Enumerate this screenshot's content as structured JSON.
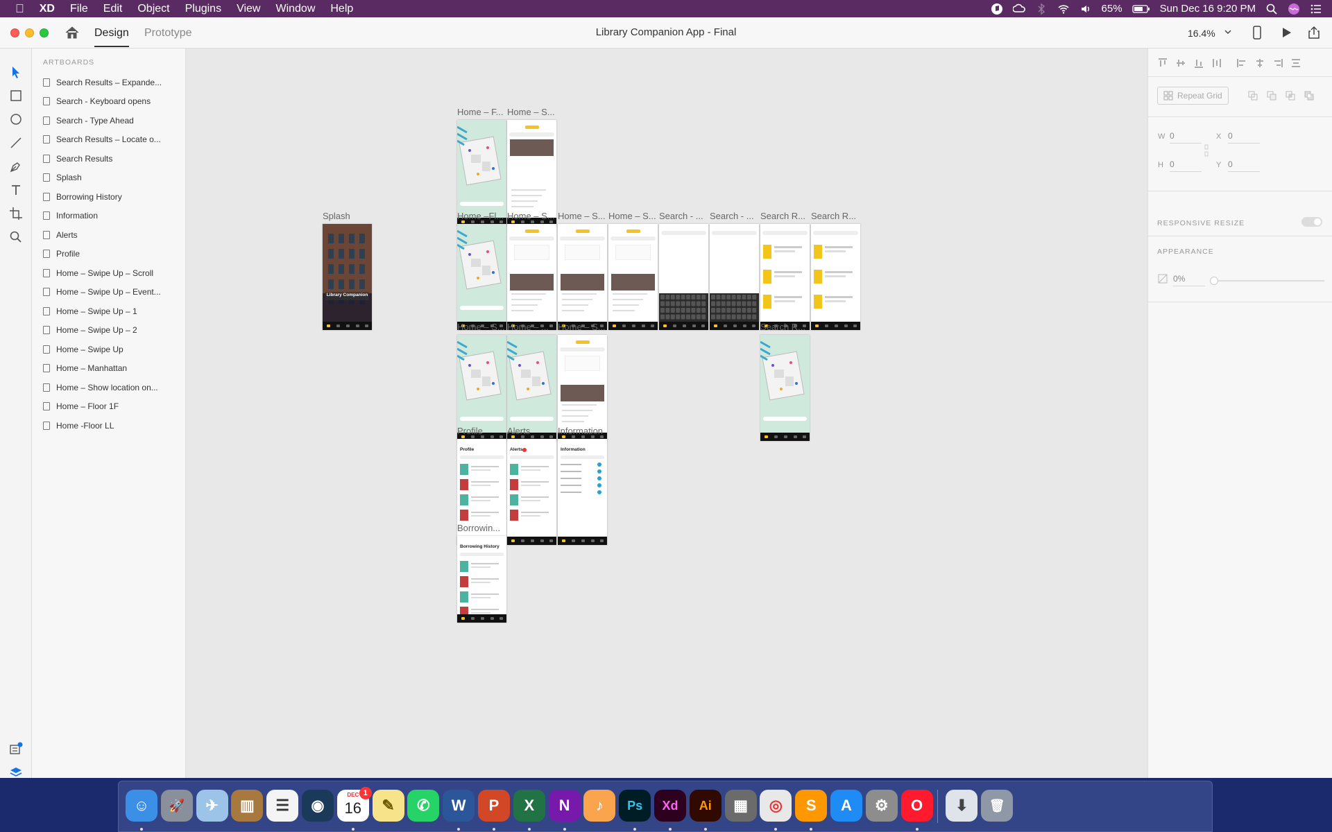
{
  "menubar": {
    "app_name": "XD",
    "menus": [
      "File",
      "Edit",
      "Object",
      "Plugins",
      "View",
      "Window",
      "Help"
    ],
    "battery": "65%",
    "datetime": "Sun Dec 16  9:20 PM"
  },
  "window": {
    "title": "Library Companion App - Final",
    "tabs": {
      "design": "Design",
      "prototype": "Prototype"
    },
    "zoom": "16.4%"
  },
  "layers": {
    "header": "ARTBOARDS",
    "items": [
      "Search Results – Expande...",
      "Search - Keyboard opens",
      "Search - Type Ahead",
      "Search Results – Locate o...",
      "Search Results",
      "Splash",
      "Borrowing History",
      "Information",
      "Alerts",
      "Profile",
      "Home – Swipe Up – Scroll",
      "Home – Swipe Up – Event...",
      "Home – Swipe Up – 1",
      "Home – Swipe Up – 2",
      "Home – Swipe Up",
      "Home – Manhattan",
      "Home – Show location on...",
      "Home – Floor 1F",
      "Home -Floor LL"
    ]
  },
  "canvas": {
    "artboards": [
      {
        "label": "Home – F...",
        "kind": "map"
      },
      {
        "label": "Home – S...",
        "kind": "detail"
      },
      {
        "label": "Splash",
        "kind": "splash",
        "text": "Library Companion"
      },
      {
        "label": "Home –Fl...",
        "kind": "map"
      },
      {
        "label": "Home – S...",
        "kind": "list"
      },
      {
        "label": "Home – S...",
        "kind": "list"
      },
      {
        "label": "Home – S...",
        "kind": "list"
      },
      {
        "label": "Search - ...",
        "kind": "keyboard"
      },
      {
        "label": "Search - ...",
        "kind": "keyboard"
      },
      {
        "label": "Search R...",
        "kind": "results"
      },
      {
        "label": "Search R...",
        "kind": "results"
      },
      {
        "label": "Home – S...",
        "kind": "map"
      },
      {
        "label": "Home – ...",
        "kind": "map"
      },
      {
        "label": "Home – S...",
        "kind": "list"
      },
      {
        "label": "Search R...",
        "kind": "map"
      },
      {
        "label": "Profile",
        "kind": "profile",
        "text": "Profile"
      },
      {
        "label": "Alerts",
        "kind": "alerts",
        "text": "Alerts"
      },
      {
        "label": "Information",
        "kind": "info",
        "text": "Information"
      },
      {
        "label": "Borrowin...",
        "kind": "history",
        "text": "Borrowing History"
      }
    ]
  },
  "props": {
    "repeat_grid": "Repeat Grid",
    "w_label": "W",
    "w_value": "0",
    "h_label": "H",
    "h_value": "0",
    "x_label": "X",
    "x_value": "0",
    "y_label": "Y",
    "y_value": "0",
    "responsive_resize": "RESPONSIVE RESIZE",
    "appearance": "APPEARANCE",
    "opacity": "0%"
  },
  "dock": {
    "apps": [
      "finder",
      "launchpad",
      "preview",
      "notebooks",
      "reminders",
      "steam",
      "calendar",
      "notes",
      "whatsapp",
      "word",
      "powerpoint",
      "excel",
      "onenote",
      "itunes",
      "photoshop",
      "xd",
      "illustrator",
      "calculator",
      "chrome",
      "sublime",
      "app-store",
      "system-preferences",
      "opera",
      "downloads",
      "trash"
    ],
    "calendar_month": "DEC",
    "calendar_day": "16",
    "calendar_badge": "1"
  }
}
